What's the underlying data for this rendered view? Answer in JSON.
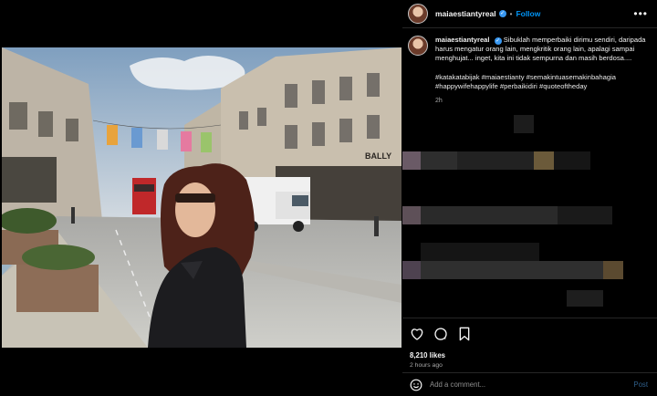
{
  "post": {
    "username": "maiaestiantyreal",
    "follow_label": "Follow",
    "separator": "•",
    "caption": "Sibuklah memperbaiki dirimu sendiri, daripada harus mengatur orang lain, mengkritik orang lain, apalagi sampai menghujat... inget, kita ini tidak sempurna dan masih berdosa....",
    "hashtags": "#katakatabijak #maiaestianty #semakintuasemakinbahagia #happywifehappylife #perbaikidiri #quoteoftheday",
    "caption_time": "2h",
    "likes": "8,210 likes",
    "posted_ago": "2 hours ago"
  },
  "comment": {
    "placeholder": "Add a comment...",
    "post_label": "Post"
  },
  "photo": {
    "bus_sign": "BALLY"
  },
  "icons": {
    "more": "more-icon",
    "like": "heart-icon",
    "comment": "comment-icon",
    "save": "bookmark-icon",
    "emoji": "emoji-icon"
  },
  "colors": {
    "follow": "#0095f6",
    "verified": "#3897f0",
    "background": "#000000",
    "divider": "#262626"
  }
}
